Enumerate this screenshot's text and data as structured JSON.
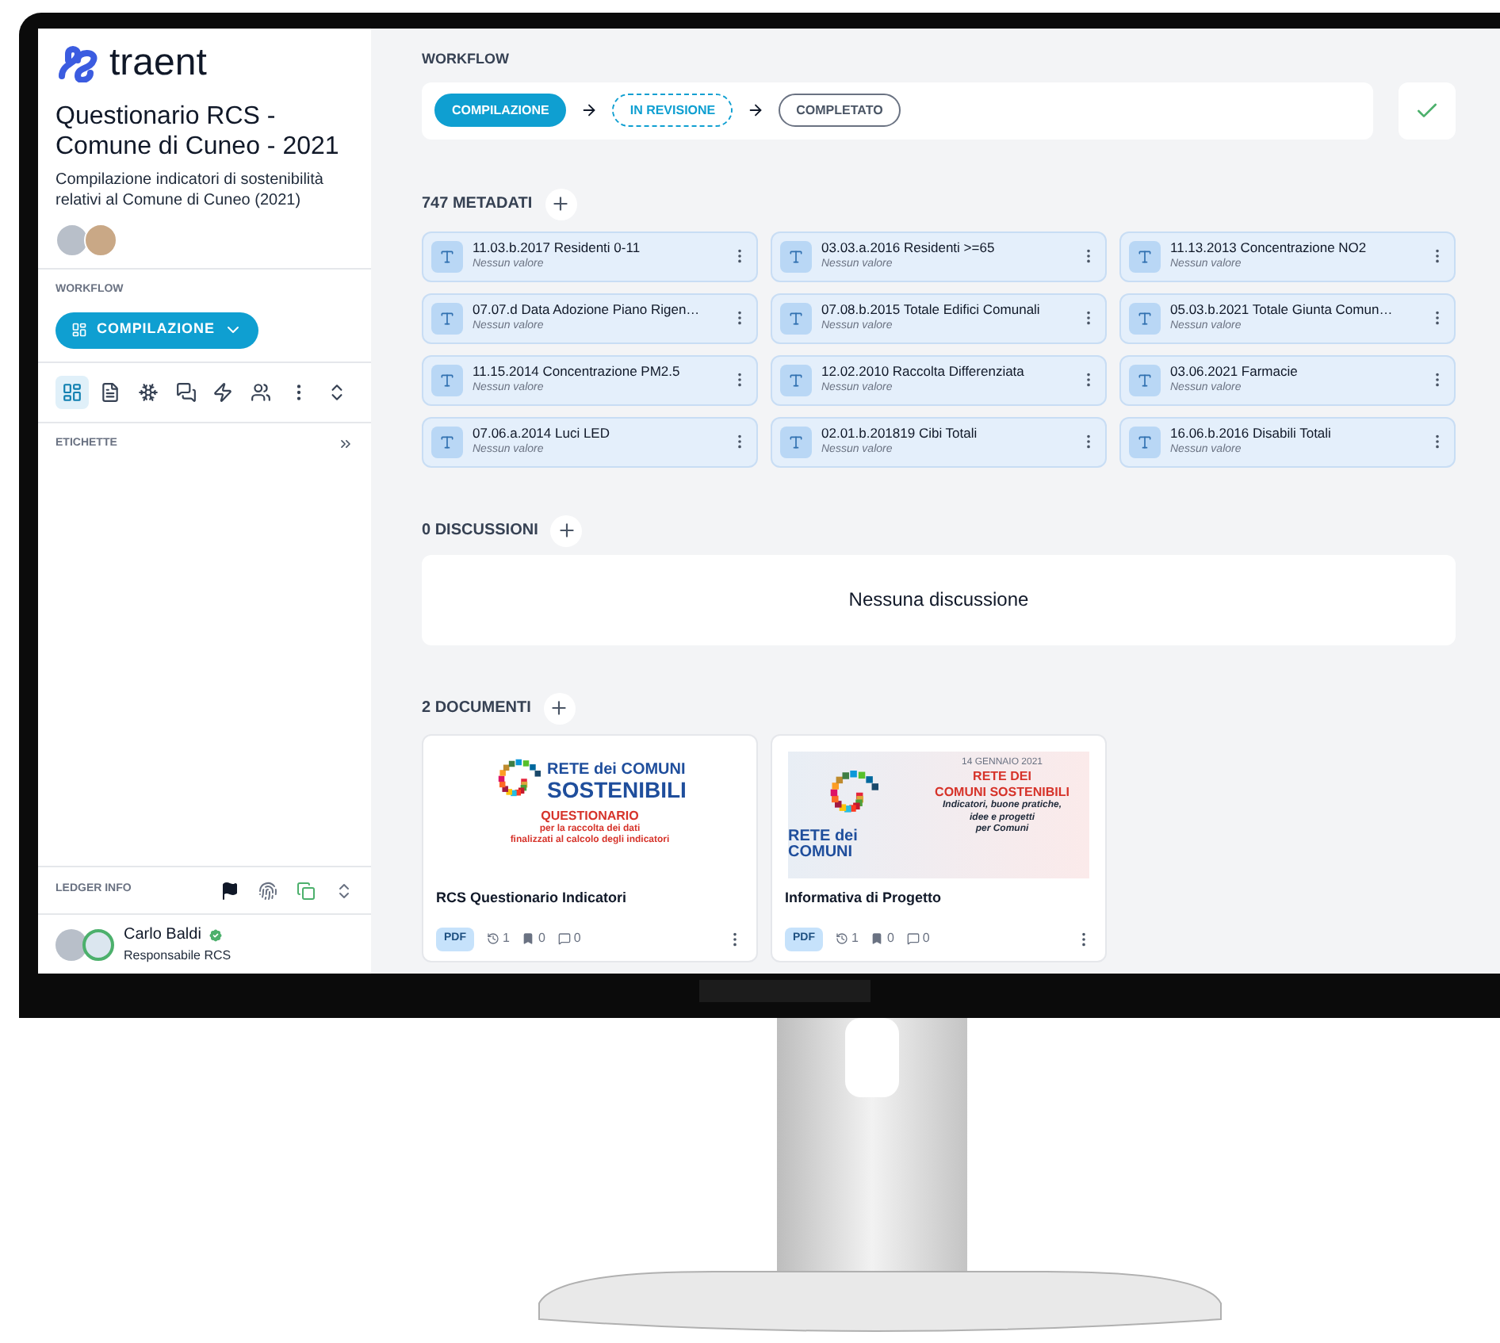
{
  "sidebar": {
    "logo_text": "traent",
    "title": "Questionario RCS - Comune di Cuneo - 2021",
    "description": "Compilazione indicatori di sostenibilità relativi al Comune di Cuneo (2021)",
    "workflow_label": "WORKFLOW",
    "workflow_button": "COMPILAZIONE",
    "tools": [
      {
        "kind": "dashboard",
        "selected": true
      },
      {
        "kind": "document",
        "selected": false
      },
      {
        "kind": "network",
        "selected": false
      },
      {
        "kind": "chat",
        "selected": false
      },
      {
        "kind": "bolt",
        "selected": false
      },
      {
        "kind": "people",
        "selected": false
      },
      {
        "kind": "more",
        "selected": false
      },
      {
        "kind": "expand",
        "selected": false
      }
    ],
    "labels_title": "ETICHETTE",
    "ledger_title": "LEDGER INFO",
    "user": {
      "name": "Carlo Baldi",
      "role": "Responsabile RCS",
      "verified": true
    }
  },
  "workflow": {
    "label": "WORKFLOW",
    "steps": [
      {
        "label": "COMPILAZIONE",
        "selected": true,
        "upcoming": false
      },
      {
        "label": "IN REVISIONE",
        "selected": false,
        "upcoming": true
      },
      {
        "label": "COMPLETATO",
        "selected": false,
        "upcoming": false
      }
    ]
  },
  "metadata": {
    "title": "747 METADATI",
    "items": [
      {
        "name": "11.03.b.2017 Residenti 0-11",
        "value": "Nessun valore"
      },
      {
        "name": "03.03.a.2016 Residenti >=65",
        "value": "Nessun valore"
      },
      {
        "name": "11.13.2013 Concentrazione NO2",
        "value": "Nessun valore"
      },
      {
        "name": "07.07.d Data Adozione Piano Rigen…",
        "value": "Nessun valore"
      },
      {
        "name": "07.08.b.2015 Totale Edifici Comunali",
        "value": "Nessun valore"
      },
      {
        "name": "05.03.b.2021 Totale Giunta Comun…",
        "value": "Nessun valore"
      },
      {
        "name": "11.15.2014 Concentrazione PM2.5",
        "value": "Nessun valore"
      },
      {
        "name": "12.02.2010 Raccolta Differenziata",
        "value": "Nessun valore"
      },
      {
        "name": "03.06.2021 Farmacie",
        "value": "Nessun valore"
      },
      {
        "name": "07.06.a.2014 Luci LED",
        "value": "Nessun valore"
      },
      {
        "name": "02.01.b.201819 Cibi Totali",
        "value": "Nessun valore"
      },
      {
        "name": "16.06.b.2016 Disabili Totali",
        "value": "Nessun valore"
      }
    ]
  },
  "discussions": {
    "title": "0 DISCUSSIONI",
    "empty": "Nessuna discussione"
  },
  "documents": {
    "title": "2 DOCUMENTI",
    "items": [
      {
        "title": "RCS Questionario Indicatori",
        "type": "PDF",
        "versions": "1",
        "notes": "0",
        "comments": "0",
        "thumbnail": {
          "kind": "cover",
          "lines": [
            {
              "kind": "brand",
              "text": "RETE dei COMUNI"
            },
            {
              "kind": "brand_big",
              "text": "SOSTENIBILI"
            },
            {
              "kind": "red_title",
              "text": "QUESTIONARIO"
            },
            {
              "kind": "red",
              "text": "per la raccolta dei dati"
            },
            {
              "kind": "red",
              "text": "finalizzati al calcolo degli indicatori"
            }
          ]
        }
      },
      {
        "title": "Informativa di Progetto",
        "type": "PDF",
        "versions": "1",
        "notes": "0",
        "comments": "0",
        "thumbnail": {
          "kind": "flyer",
          "lines": [
            {
              "kind": "brand",
              "text": "RETE dei COMUNI"
            },
            {
              "kind": "date",
              "text": "14 GENNAIO 2021"
            },
            {
              "kind": "red_title",
              "text": "RETE DEI"
            },
            {
              "kind": "red_title",
              "text": "COMUNI SOSTENIBILI"
            },
            {
              "kind": "italic",
              "text": "Indicatori, buone pratiche,"
            },
            {
              "kind": "italic",
              "text": "idee e progetti"
            },
            {
              "kind": "italic",
              "text": "per Comuni"
            }
          ]
        }
      }
    ]
  }
}
